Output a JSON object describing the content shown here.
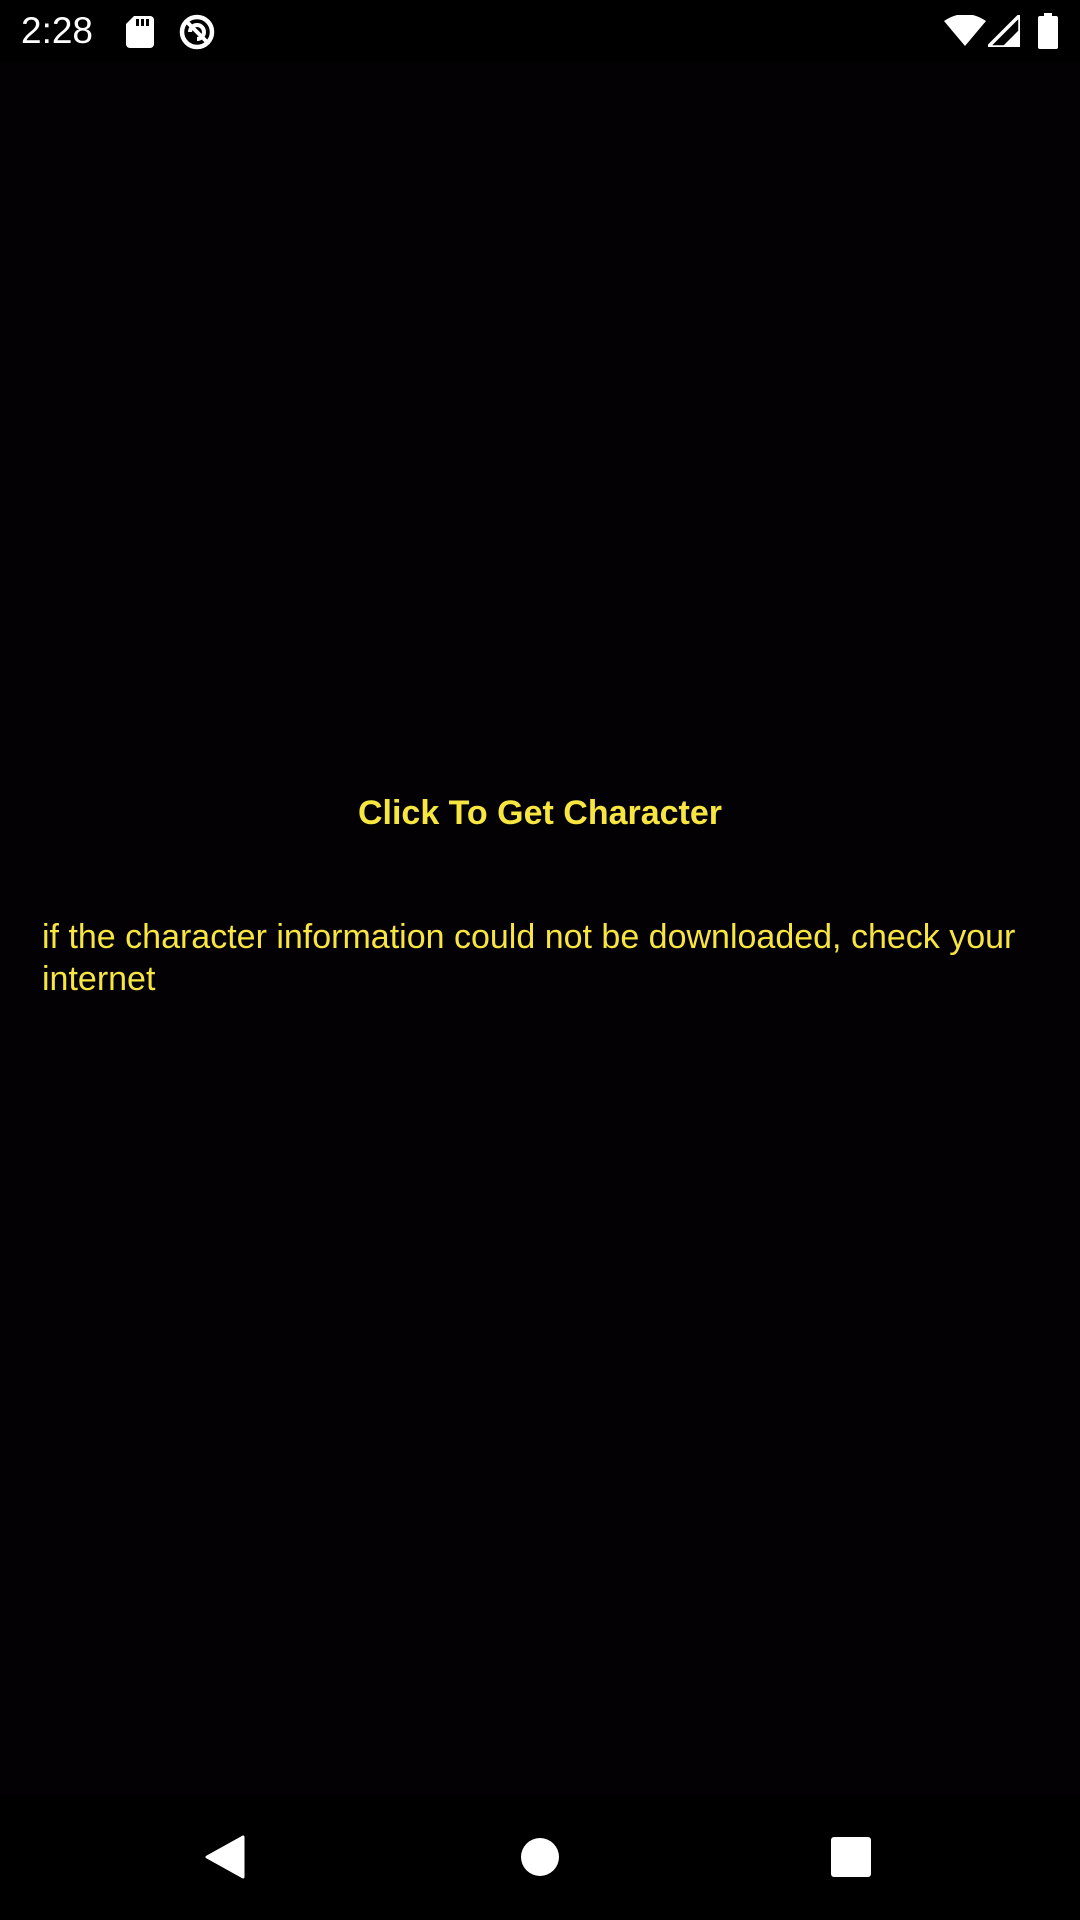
{
  "status_bar": {
    "time": "2:28",
    "icons_left": [
      "sd-card-icon",
      "no-tracking-icon"
    ],
    "icons_right": [
      "wifi-icon",
      "cell-signal-icon",
      "battery-icon"
    ]
  },
  "main": {
    "button_label": "Click To Get Character",
    "info_text": "if the character information could not be downloaded, check your internet"
  },
  "nav_bar": {
    "buttons": [
      "back-icon",
      "home-icon",
      "recents-icon"
    ]
  },
  "colors": {
    "background": "#040105",
    "accent_text": "#f7e640",
    "status_icons": "#ffffff"
  }
}
